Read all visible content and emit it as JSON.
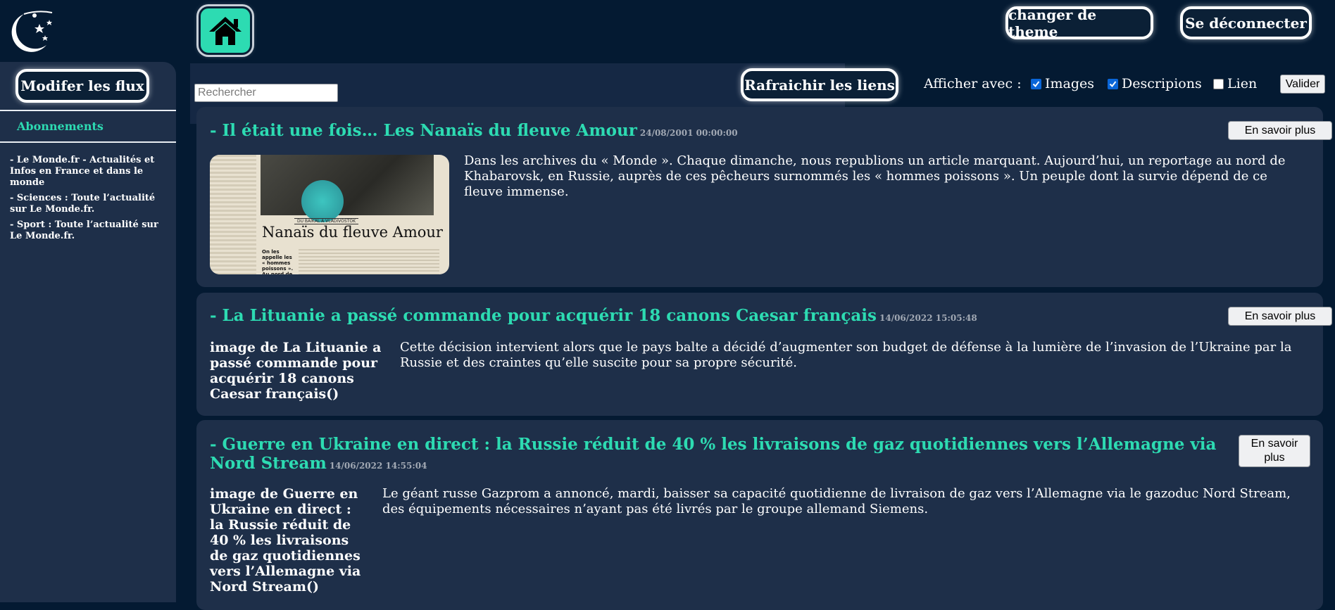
{
  "header": {
    "theme_button": "changer de theme",
    "logout_button": "Se déconnecter"
  },
  "sidebar": {
    "edit_feeds_button": "Modifer les flux",
    "title": "Abonnements",
    "feeds": [
      "- Le Monde.fr - Actualités et Infos en France et dans le monde",
      "- Sciences : Toute l’actualité sur Le Monde.fr.",
      "- Sport : Toute l’actualité sur Le Monde.fr."
    ]
  },
  "toolbar": {
    "search_placeholder": "Rechercher",
    "refresh_button": "Rafraichir les liens",
    "show_label": "Afficher avec :",
    "options": [
      {
        "label": "Images",
        "checked": true
      },
      {
        "label": "Descripions",
        "checked": true
      },
      {
        "label": "Lien",
        "checked": false
      }
    ],
    "validate_button": "Valider"
  },
  "articles": [
    {
      "title": "- Il était une fois… Les Nanaïs du fleuve Amour",
      "date": "24/08/2001 00:00:00",
      "more_button": "En savoir plus",
      "image_headline": "Nanaïs du fleuve Amour",
      "image_kicker": "DU BAÏKAL À VLADIVOSTOK",
      "image_caption": "On les appelle les « hommes poissons ». Au nord de Khabarovsk,",
      "description": "Dans les archives du « Monde ». Chaque dimanche, nous republions un article marquant. Aujourd’hui, un reportage au nord de Khabarovsk, en Russie, auprès de ces pêcheurs surnommés les « hommes poissons ». Un peuple dont la survie dépend de ce fleuve immense."
    },
    {
      "title": "- La Lituanie a passé commande pour acquérir 18 canons Caesar français",
      "date": "14/06/2022 15:05:48",
      "more_button": "En savoir plus",
      "image_alt": "image de La Lituanie a passé commande pour acquérir 18 canons Caesar français()",
      "description": "Cette décision intervient alors que le pays balte a décidé d’augmenter son budget de défense à la lumière de l’invasion de l’Ukraine par la Russie et des craintes qu’elle suscite pour sa propre sécurité."
    },
    {
      "title": "- Guerre en Ukraine en direct : la Russie réduit de 40 % les livraisons de gaz quotidiennes vers l’Allemagne via Nord Stream",
      "date": "14/06/2022 14:55:04",
      "more_button": "En savoir plus",
      "image_alt": "image de Guerre en Ukraine en direct : la Russie réduit de 40 % les livraisons de gaz quotidiennes vers l’Allemagne via Nord Stream()",
      "description": "Le géant russe Gazprom a annoncé, mardi, baisser sa capacité quotidienne de livraison de gaz vers l’Allemagne via le gazoduc Nord Stream, des équipements nécessaires n’ayant pas été livrés par le groupe allemand Siemens."
    }
  ],
  "colors": {
    "background": "#041a32",
    "panel": "#1e2f49",
    "accent": "#2ddbb2"
  },
  "icons": [
    "moon-stars-logo-icon",
    "home-icon",
    "checkbox-icon"
  ]
}
